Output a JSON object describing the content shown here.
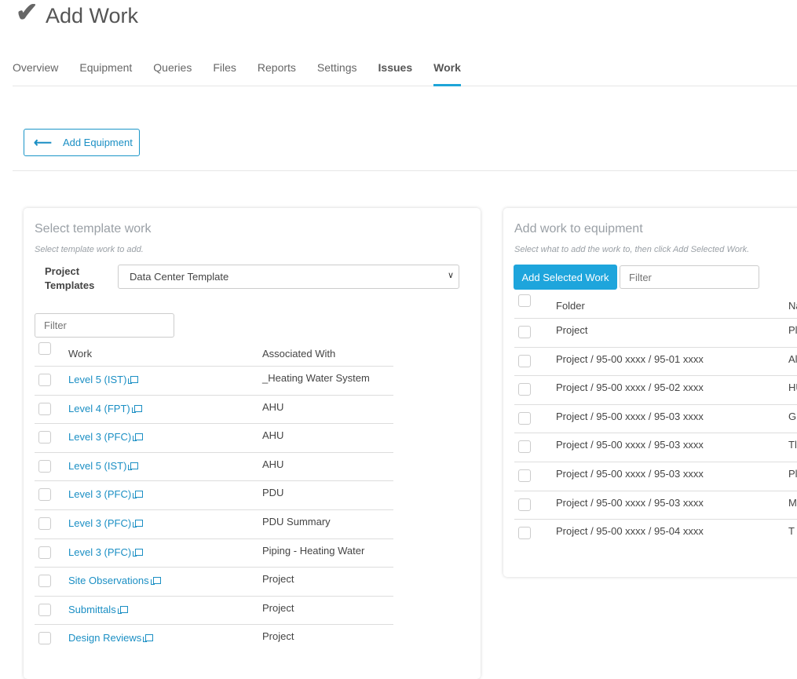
{
  "header": {
    "title": "Add Work",
    "icon": "checkmark-icon"
  },
  "tabs": [
    {
      "label": "Overview",
      "bold": false,
      "active": false
    },
    {
      "label": "Equipment",
      "bold": false,
      "active": false
    },
    {
      "label": "Queries",
      "bold": false,
      "active": false
    },
    {
      "label": "Files",
      "bold": false,
      "active": false
    },
    {
      "label": "Reports",
      "bold": false,
      "active": false
    },
    {
      "label": "Settings",
      "bold": false,
      "active": false
    },
    {
      "label": "Issues",
      "bold": true,
      "active": false
    },
    {
      "label": "Work",
      "bold": true,
      "active": true
    }
  ],
  "back_button": {
    "label": "Add Equipment",
    "icon": "arrow-left-icon"
  },
  "template_panel": {
    "title": "Select template work",
    "subtitle": "Select template work to add.",
    "project_templates_label": "Project Templates",
    "selected_template": "Data Center Template",
    "filter_placeholder": "Filter",
    "columns": [
      "Work",
      "Associated With"
    ],
    "rows": [
      {
        "work": "Level 5 (IST)",
        "associated": "_Heating Water System"
      },
      {
        "work": "Level 4 (FPT)",
        "associated": "AHU"
      },
      {
        "work": "Level 3 (PFC)",
        "associated": "AHU"
      },
      {
        "work": "Level 5 (IST)",
        "associated": "AHU"
      },
      {
        "work": "Level 3 (PFC)",
        "associated": "PDU"
      },
      {
        "work": "Level 3 (PFC)",
        "associated": "PDU Summary"
      },
      {
        "work": "Level 3 (PFC)",
        "associated": "Piping - Heating Water"
      },
      {
        "work": "Site Observations",
        "associated": "Project"
      },
      {
        "work": "Submittals",
        "associated": "Project"
      },
      {
        "work": "Design Reviews",
        "associated": "Project"
      }
    ]
  },
  "equipment_panel": {
    "title": "Add work to equipment",
    "subtitle": "Select what to add the work to, then click Add Selected Work.",
    "add_button": "Add Selected Work",
    "filter_placeholder": "Filter",
    "columns": [
      "Folder",
      "Na"
    ],
    "rows": [
      {
        "folder": "Project",
        "name": "Pl"
      },
      {
        "folder": "Project / 95-00 xxxx / 95-01 xxxx",
        "name": "Al"
      },
      {
        "folder": "Project / 95-00 xxxx / 95-02 xxxx",
        "name": "HU"
      },
      {
        "folder": "Project / 95-00 xxxx / 95-03 xxxx",
        "name": "G"
      },
      {
        "folder": "Project / 95-00 xxxx / 95-03 xxxx",
        "name": "Tl"
      },
      {
        "folder": "Project / 95-00 xxxx / 95-03 xxxx",
        "name": "Pl"
      },
      {
        "folder": "Project / 95-00 xxxx / 95-03 xxxx",
        "name": "M"
      },
      {
        "folder": "Project / 95-00 xxxx / 95-04 xxxx",
        "name": "T"
      }
    ]
  },
  "colors": {
    "accent": "#1ea5dc",
    "link": "#1b8fc4"
  }
}
